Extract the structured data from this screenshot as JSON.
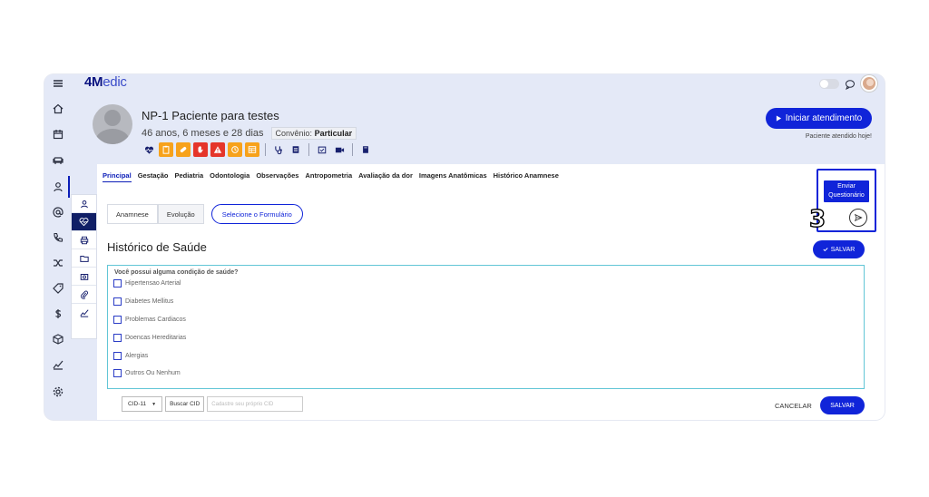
{
  "app": {
    "logo_bold": "4M",
    "logo_rest": "edic"
  },
  "patient": {
    "name": "NP-1 Paciente para testes",
    "age": "46 anos, 6 meses e 28 dias",
    "convenio_label": "Convênio:",
    "convenio_value": "Particular",
    "attended_note": "Paciente atendido hoje!"
  },
  "header": {
    "start_button": "Iniciar atendimento"
  },
  "tabs": [
    {
      "label": "Principal",
      "active": true
    },
    {
      "label": "Gestação"
    },
    {
      "label": "Pediatria"
    },
    {
      "label": "Odontologia"
    },
    {
      "label": "Observações"
    },
    {
      "label": "Antropometria"
    },
    {
      "label": "Avaliação da dor"
    },
    {
      "label": "Imagens Anatômicas"
    },
    {
      "label": "Histórico Anamnese"
    }
  ],
  "segment": {
    "anamnese": "Anamnese",
    "evolucao": "Evolução",
    "select_form": "Selecione o Formulário"
  },
  "section": {
    "title": "Histórico de Saúde",
    "save_top": "SALVAR"
  },
  "enviar": {
    "line1": "Enviar",
    "line2": "Questionário"
  },
  "callout": {
    "step": "3"
  },
  "question": {
    "label": "Você possui alguma condição de saúde?",
    "options": [
      "Hipertensao Arterial",
      "Diabetes Mellitus",
      "Problemas Cardiacos",
      "Doencas Hereditarias",
      "Alergias",
      "Outros Ou Nenhum"
    ]
  },
  "cid": {
    "version": "CID-11",
    "buscar": "Buscar CID",
    "placeholder": "Cadastre seu próprio CID"
  },
  "footer": {
    "cancel": "CANCELAR",
    "save": "SALVAR"
  },
  "colors": {
    "primary": "#1024d9",
    "navy": "#101f66",
    "orange": "#f7a21b",
    "red": "#e5352a",
    "teal_border": "#62c6d6"
  }
}
